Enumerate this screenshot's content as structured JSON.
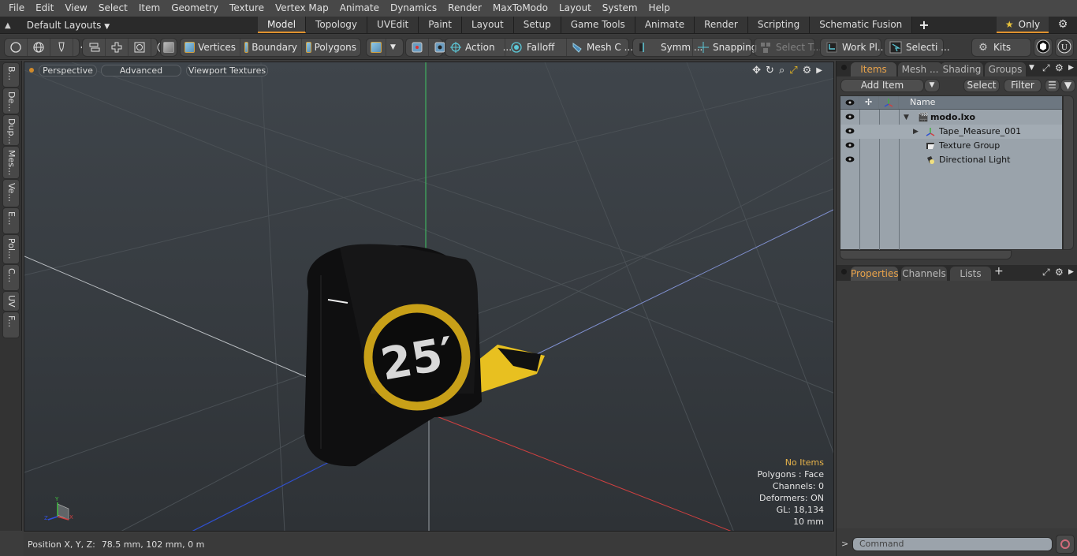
{
  "menubar": {
    "items": [
      "File",
      "Edit",
      "View",
      "Select",
      "Item",
      "Geometry",
      "Texture",
      "Vertex Map",
      "Animate",
      "Dynamics",
      "Render",
      "MaxToModo",
      "Layout",
      "System",
      "Help"
    ]
  },
  "layoutbar": {
    "layouts_label": "Default Layouts",
    "tabs": [
      "Model",
      "Topology",
      "UVEdit",
      "Paint",
      "Layout",
      "Setup",
      "Game Tools",
      "Animate",
      "Render",
      "Scripting",
      "Schematic Fusion"
    ],
    "active_tab": "Model",
    "add_tab": "+",
    "only_label": "Only"
  },
  "toolbar": {
    "vertices": "Vertices",
    "boundary": "Boundary",
    "polygons": "Polygons",
    "action": "Action",
    "action_more": "...",
    "falloff": "Falloff",
    "mesh_c": "Mesh C ...",
    "symm": "Symm ...",
    "snapping": "Snapping",
    "select_t": "Select T...",
    "work_pl": "Work Pl...",
    "selecti": "Selecti ...",
    "kits": "Kits"
  },
  "left_strip": {
    "tabs": [
      "B...",
      "De...",
      "Dup...",
      "Mes...",
      "Ve...",
      "E...",
      "Pol...",
      "C...",
      "UV",
      "F..."
    ]
  },
  "viewport": {
    "view_mode": "Perspective",
    "shading": "Advanced",
    "textures": "Viewport Textures",
    "model_label": "25′",
    "info": {
      "selection": "No Items",
      "polygons": "Polygons : Face",
      "channels": "Channels: 0",
      "deformers": "Deformers: ON",
      "gl": "GL: 18,134",
      "grid": "10 mm"
    }
  },
  "statusbar": {
    "label": "Position X, Y, Z:",
    "value": "78.5 mm, 102 mm, 0 m"
  },
  "items_panel": {
    "tabs": [
      "Items",
      "Mesh ...",
      "Shading",
      "Groups"
    ],
    "active_tab": "Items",
    "add_item": "Add Item",
    "select": "Select",
    "filter": "Filter",
    "column_name": "Name",
    "rows": [
      {
        "name": "modo.lxo",
        "icon": "scene-icon",
        "level": 0
      },
      {
        "name": "Tape_Measure_001",
        "icon": "mesh-locator-icon",
        "level": 1
      },
      {
        "name": "Texture Group",
        "icon": "texture-group-icon",
        "level": 1
      },
      {
        "name": "Directional Light",
        "icon": "directional-light-icon",
        "level": 1
      }
    ]
  },
  "properties_panel": {
    "tabs": [
      "Properties",
      "Channels",
      "Lists"
    ],
    "active_tab": "Properties",
    "add_tab": "+"
  },
  "command": {
    "prompt": ">",
    "placeholder": "Command"
  },
  "colors": {
    "accent": "#e0922e",
    "axis_x": "#d04040",
    "axis_y": "#40c040",
    "axis_z": "#4060e0"
  }
}
